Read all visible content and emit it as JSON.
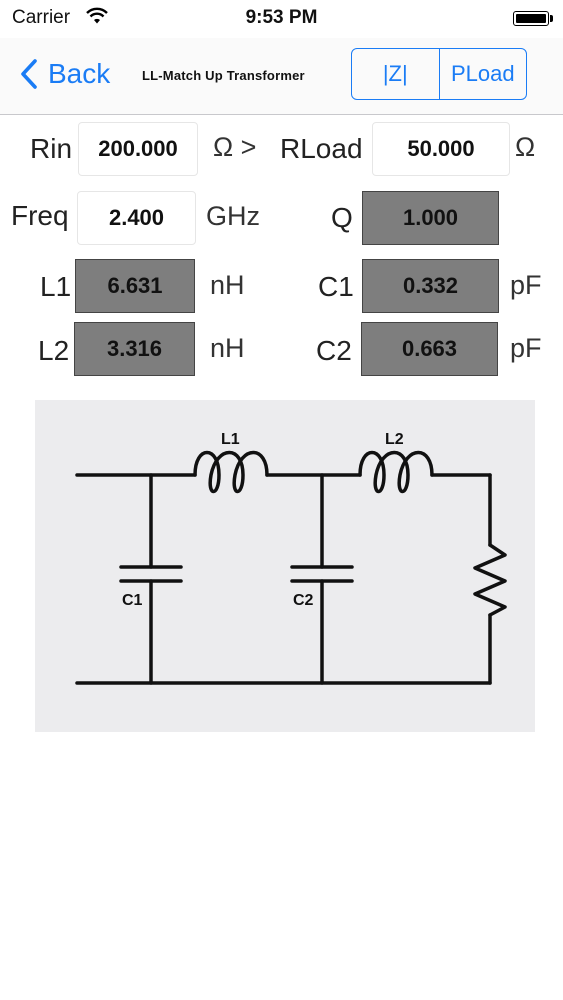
{
  "status": {
    "carrier": "Carrier",
    "time": "9:53 PM"
  },
  "nav": {
    "back_label": "Back",
    "title": "LL-Match Up Transformer",
    "segments": [
      "|Z|",
      "PLoad"
    ]
  },
  "form": {
    "rin_label": "Rin",
    "rin_value": "200.000",
    "rin_unit": "Ω >",
    "rload_label": "RLoad",
    "rload_value": "50.000",
    "rload_unit": "Ω",
    "freq_label": "Freq",
    "freq_value": "2.400",
    "freq_unit": "GHz",
    "q_label": "Q",
    "q_value": "1.000",
    "l1_label": "L1",
    "l1_value": "6.631",
    "l1_unit": "nH",
    "c1_label": "C1",
    "c1_value": "0.332",
    "c1_unit": "pF",
    "l2_label": "L2",
    "l2_value": "3.316",
    "l2_unit": "nH",
    "c2_label": "C2",
    "c2_value": "0.663",
    "c2_unit": "pF"
  },
  "schematic": {
    "labels": {
      "l1": "L1",
      "l2": "L2",
      "c1": "C1",
      "c2": "C2"
    }
  }
}
